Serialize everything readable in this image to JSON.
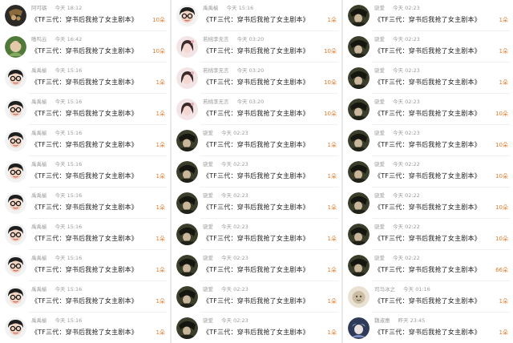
{
  "accent_color": "#e27b2a",
  "columns": [
    {
      "rows": [
        {
          "user": "阿可砺",
          "time": "今天 18:12",
          "book": "《TF三代：穿书后我抢了女主剧本》",
          "amount": "10朵",
          "avatar": "monkey"
        },
        {
          "user": "嗷呜云",
          "time": "今天 16:42",
          "book": "《TF三代：穿书后我抢了女主剧本》",
          "amount": "10朵",
          "avatar": "green"
        },
        {
          "user": "禹禹榆",
          "time": "今天 15:16",
          "book": "《TF三代：穿书后我抢了女主剧本》",
          "amount": "1朵",
          "avatar": "glasses"
        },
        {
          "user": "禹禹榆",
          "time": "今天 15:16",
          "book": "《TF三代：穿书后我抢了女主剧本》",
          "amount": "1朵",
          "avatar": "glasses"
        },
        {
          "user": "禹禹榆",
          "time": "今天 15:16",
          "book": "《TF三代：穿书后我抢了女主剧本》",
          "amount": "1朵",
          "avatar": "glasses"
        },
        {
          "user": "禹禹榆",
          "time": "今天 15:16",
          "book": "《TF三代：穿书后我抢了女主剧本》",
          "amount": "1朵",
          "avatar": "glasses"
        },
        {
          "user": "禹禹榆",
          "time": "今天 15:16",
          "book": "《TF三代：穿书后我抢了女主剧本》",
          "amount": "1朵",
          "avatar": "glasses"
        },
        {
          "user": "禹禹榆",
          "time": "今天 15:16",
          "book": "《TF三代：穿书后我抢了女主剧本》",
          "amount": "1朵",
          "avatar": "glasses"
        },
        {
          "user": "禹禹榆",
          "time": "今天 15:16",
          "book": "《TF三代：穿书后我抢了女主剧本》",
          "amount": "1朵",
          "avatar": "glasses"
        },
        {
          "user": "禹禹榆",
          "time": "今天 15:16",
          "book": "《TF三代：穿书后我抢了女主剧本》",
          "amount": "1朵",
          "avatar": "glasses"
        },
        {
          "user": "禹禹榆",
          "time": "今天 15:16",
          "book": "《TF三代：穿书后我抢了女主剧本》",
          "amount": "1朵",
          "avatar": "glasses"
        }
      ]
    },
    {
      "rows": [
        {
          "user": "禹禹榆",
          "time": "今天 15:16",
          "book": "《TF三代：穿书后我抢了女主剧本》",
          "amount": "1朵",
          "avatar": "glasses"
        },
        {
          "user": "若桃李无言",
          "time": "今天 03:20",
          "book": "《TF三代：穿书后我抢了女主剧本》",
          "amount": "10朵",
          "avatar": "pink"
        },
        {
          "user": "若桃李无言",
          "time": "今天 03:20",
          "book": "《TF三代：穿书后我抢了女主剧本》",
          "amount": "10朵",
          "avatar": "pink"
        },
        {
          "user": "若桃李无言",
          "time": "今天 03:20",
          "book": "《TF三代：穿书后我抢了女主剧本》",
          "amount": "10朵",
          "avatar": "pink"
        },
        {
          "user": "骁爱",
          "time": "今天 02:23",
          "book": "《TF三代：穿书后我抢了女主剧本》",
          "amount": "1朵",
          "avatar": "dark"
        },
        {
          "user": "骁爱",
          "time": "今天 02:23",
          "book": "《TF三代：穿书后我抢了女主剧本》",
          "amount": "1朵",
          "avatar": "dark"
        },
        {
          "user": "骁爱",
          "time": "今天 02:23",
          "book": "《TF三代：穿书后我抢了女主剧本》",
          "amount": "1朵",
          "avatar": "dark"
        },
        {
          "user": "骁爱",
          "time": "今天 02:23",
          "book": "《TF三代：穿书后我抢了女主剧本》",
          "amount": "1朵",
          "avatar": "dark"
        },
        {
          "user": "骁爱",
          "time": "今天 02:23",
          "book": "《TF三代：穿书后我抢了女主剧本》",
          "amount": "1朵",
          "avatar": "dark"
        },
        {
          "user": "骁爱",
          "time": "今天 02:23",
          "book": "《TF三代：穿书后我抢了女主剧本》",
          "amount": "1朵",
          "avatar": "dark"
        },
        {
          "user": "骁爱",
          "time": "今天 02:23",
          "book": "《TF三代：穿书后我抢了女主剧本》",
          "amount": "1朵",
          "avatar": "dark"
        }
      ]
    },
    {
      "rows": [
        {
          "user": "骁爱",
          "time": "今天 02:23",
          "book": "《TF三代：穿书后我抢了女主剧本》",
          "amount": "1朵",
          "avatar": "dark"
        },
        {
          "user": "骁爱",
          "time": "今天 02:23",
          "book": "《TF三代：穿书后我抢了女主剧本》",
          "amount": "1朵",
          "avatar": "dark"
        },
        {
          "user": "骁爱",
          "time": "今天 02:23",
          "book": "《TF三代：穿书后我抢了女主剧本》",
          "amount": "1朵",
          "avatar": "dark"
        },
        {
          "user": "骁爱",
          "time": "今天 02:23",
          "book": "《TF三代：穿书后我抢了女主剧本》",
          "amount": "10朵",
          "avatar": "dark"
        },
        {
          "user": "骁爱",
          "time": "今天 02:23",
          "book": "《TF三代：穿书后我抢了女主剧本》",
          "amount": "10朵",
          "avatar": "dark"
        },
        {
          "user": "骁爱",
          "time": "今天 02:22",
          "book": "《TF三代：穿书后我抢了女主剧本》",
          "amount": "10朵",
          "avatar": "dark"
        },
        {
          "user": "骁爱",
          "time": "今天 02:22",
          "book": "《TF三代：穿书后我抢了女主剧本》",
          "amount": "10朵",
          "avatar": "dark"
        },
        {
          "user": "骁爱",
          "time": "今天 02:22",
          "book": "《TF三代：穿书后我抢了女主剧本》",
          "amount": "10朵",
          "avatar": "dark"
        },
        {
          "user": "骁爱",
          "time": "今天 02:22",
          "book": "《TF三代：穿书后我抢了女主剧本》",
          "amount": "66朵",
          "avatar": "dark"
        },
        {
          "user": "司马冰之",
          "time": "今天 01:16",
          "book": "《TF三代：穿书后我抢了女主剧本》",
          "amount": "1朵",
          "avatar": "beige"
        },
        {
          "user": "魏淑惠",
          "time": "昨天 23:45",
          "book": "《TF三代：穿书后我抢了女主剧本》",
          "amount": "1朵",
          "avatar": "navy"
        }
      ]
    }
  ]
}
